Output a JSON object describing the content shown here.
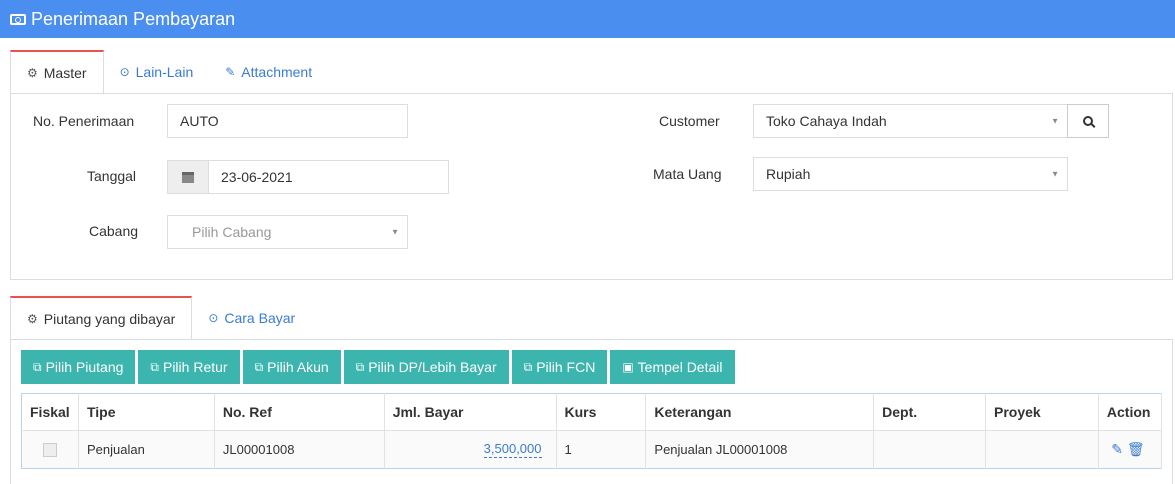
{
  "header": {
    "title": "Penerimaan Pembayaran",
    "icon": "money-icon"
  },
  "master_tabs": [
    {
      "label": "Master",
      "icon": "cogs-icon",
      "active": true
    },
    {
      "label": "Lain-Lain",
      "icon": "check-circle-icon",
      "active": false
    },
    {
      "label": "Attachment",
      "icon": "paperclip-icon",
      "active": false
    }
  ],
  "form": {
    "no_penerimaan": {
      "label": "No. Penerimaan",
      "value": "AUTO"
    },
    "tanggal": {
      "label": "Tanggal",
      "value": "23-06-2021"
    },
    "cabang": {
      "label": "Cabang",
      "placeholder": "Pilih Cabang"
    },
    "customer": {
      "label": "Customer",
      "value": "Toko Cahaya Indah"
    },
    "mata_uang": {
      "label": "Mata Uang",
      "value": "Rupiah"
    }
  },
  "detail_tabs": [
    {
      "label": "Piutang yang dibayar",
      "icon": "cogs-icon",
      "active": true
    },
    {
      "label": "Cara Bayar",
      "icon": "check-circle-icon",
      "active": false
    }
  ],
  "toolbar": [
    {
      "label": "Pilih Piutang",
      "icon": "copy-icon"
    },
    {
      "label": "Pilih Retur",
      "icon": "copy-icon"
    },
    {
      "label": "Pilih Akun",
      "icon": "copy-icon"
    },
    {
      "label": "Pilih DP/Lebih Bayar",
      "icon": "copy-icon"
    },
    {
      "label": "Pilih FCN",
      "icon": "copy-icon"
    },
    {
      "label": "Tempel Detail",
      "icon": "paste-icon"
    }
  ],
  "table": {
    "columns": [
      "Fiskal",
      "Tipe",
      "No. Ref",
      "Jml. Bayar",
      "Kurs",
      "Keterangan",
      "Dept.",
      "Proyek",
      "Action"
    ],
    "rows": [
      {
        "fiskal": false,
        "tipe": "Penjualan",
        "no_ref": "JL00001008",
        "jml_bayar": "3,500,000",
        "kurs": "1",
        "keterangan": "Penjualan JL00001008",
        "dept": "",
        "proyek": ""
      }
    ]
  },
  "colors": {
    "header_bg": "#4a8ef0",
    "button_bg": "#3bb5ad",
    "active_tab_border": "#e8534f",
    "link": "#3a7bd5"
  }
}
